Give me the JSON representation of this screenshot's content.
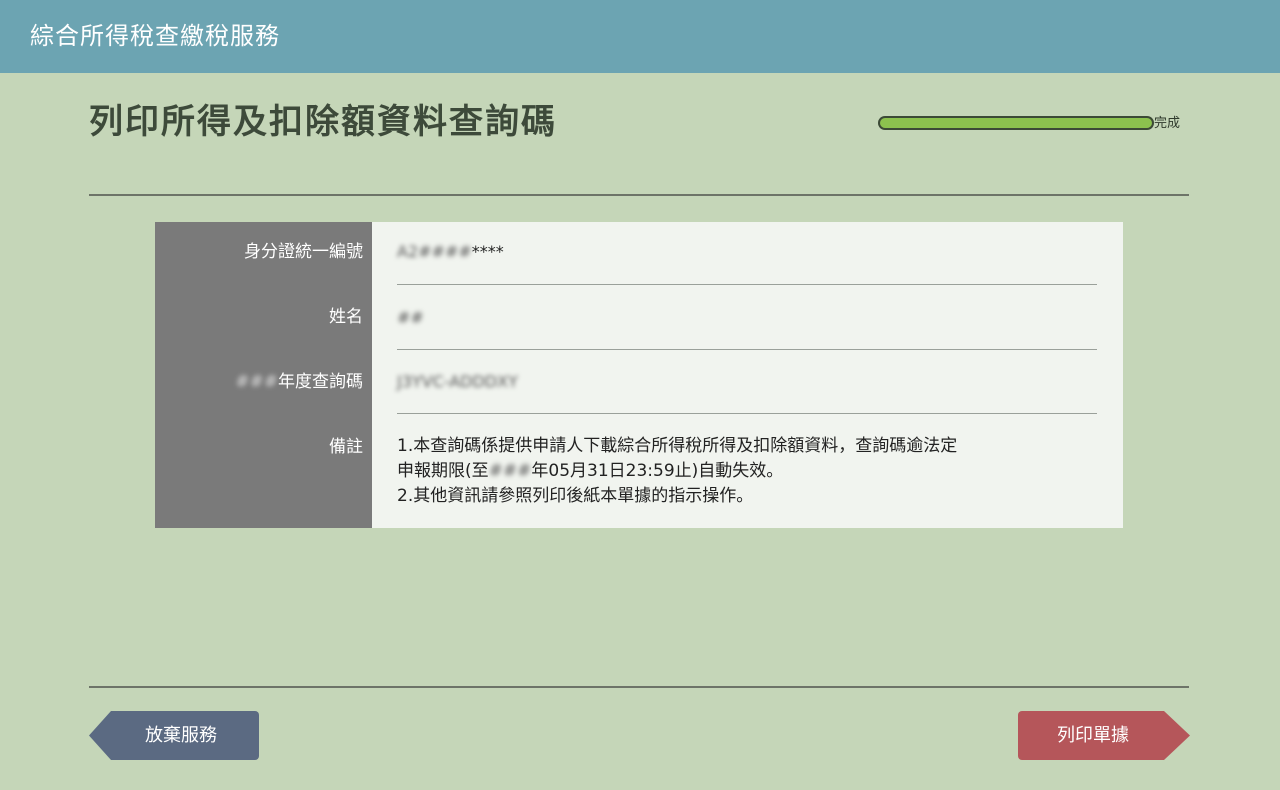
{
  "header": {
    "title": "綜合所得稅查繳稅服務"
  },
  "page": {
    "title": "列印所得及扣除額資料查詢碼"
  },
  "progress": {
    "label": "完成",
    "fraction": 1.0,
    "fill_color": "#8cc24e"
  },
  "info": {
    "id_label": "身分證統一編號",
    "id_value_masked": "A2####",
    "id_value_suffix": "****",
    "name_label": "姓名",
    "name_value_masked": "##",
    "code_label_masked": "###",
    "code_label_suffix": "年度查詢碼",
    "code_value_masked": "J3YVC-ADDDXY",
    "note_label": "備註",
    "note_line1": "1.本查詢碼係提供申請人下載綜合所得稅所得及扣除額資料，查詢碼逾法定",
    "note_line2_prefix": "申報期限(至",
    "note_line2_masked": "###",
    "note_line2_suffix": "年05月31日23:59止)自動失效。",
    "note_line3": "2.其他資訊請參照列印後紙本單據的指示操作。"
  },
  "buttons": {
    "back_label": "放棄服務",
    "print_label": "列印單據"
  },
  "colors": {
    "header_bg": "#6ca4b2",
    "page_bg": "#c5d6b8",
    "label_col_bg": "#7a7a7a",
    "back_button": "#5b6a82",
    "print_button": "#b5565a"
  }
}
